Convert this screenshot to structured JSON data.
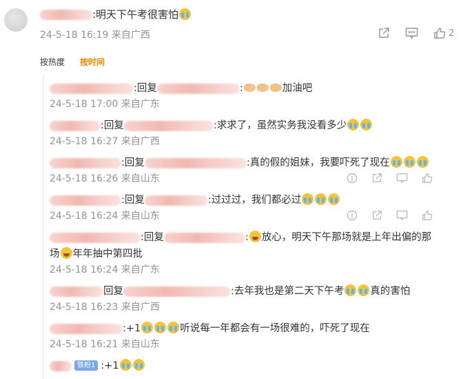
{
  "root": {
    "text": ":明天下午考很害怕",
    "meta": "24-5-18 16:19 来自广西",
    "like_count": "2",
    "icons": [
      "share-icon",
      "comment-icon",
      "like-icon"
    ]
  },
  "sort": {
    "by_heat": "按热度",
    "by_time": "按时间"
  },
  "replies": [
    {
      "reply": ":回复",
      "text": ":",
      "tail": "加油吧",
      "emojis": [
        "fist",
        "fist",
        "fist"
      ],
      "meta": "24-5-18 17:00 来自广东"
    },
    {
      "reply": ":回复",
      "text": ":求求了，虽然实务我没看多少",
      "emojis": [
        "cry",
        "cry"
      ],
      "meta": "24-5-18 16:27 来自广西"
    },
    {
      "reply": ":回复",
      "text": ":真的假的姐妹，我要吓死了现在",
      "emojis": [
        "cry",
        "cry",
        "cry"
      ],
      "meta": "24-5-18 16:26 来自山东"
    },
    {
      "reply": ":回复",
      "text": ":过过过，我们都必过",
      "emojis": [
        "cry",
        "cry",
        "cry"
      ],
      "meta": "24-5-18 16:24 来自山东"
    },
    {
      "reply": ":回复",
      "text": ":",
      "text2": "放心，明天下午那场就是上年出偏的那",
      "text3": "场",
      "text4": "年年抽中第四批",
      "meta": "24-5-18 16:24 来自广东"
    },
    {
      "reply": "回复",
      "text": ":去年我也是第二天下午考",
      "tail": "真的害怕",
      "meta": "24-5-18 16:23 来自广西"
    },
    {
      "reply": "",
      "text": ":+1",
      "tail": "听说每一年都会有一场很难的，吓死了现在",
      "meta": "24-5-18 16:21 来自山东"
    },
    {
      "badge": "铁粉1",
      "text": ":+1"
    }
  ]
}
